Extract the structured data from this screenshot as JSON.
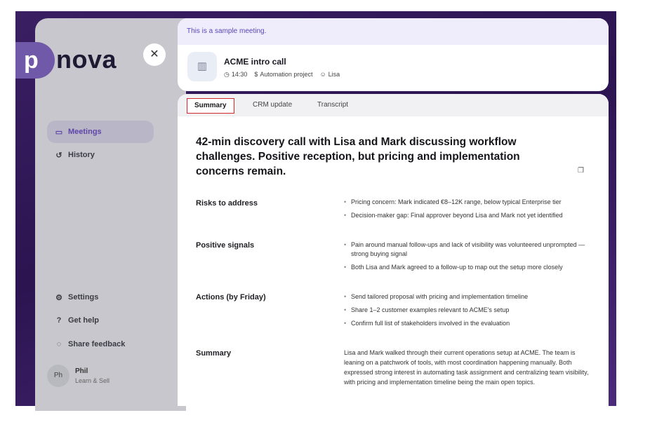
{
  "sidebar": {
    "logo_mark": "p",
    "logo_text": "nova",
    "close_label": "✕",
    "nav": [
      {
        "label": "Meetings",
        "icon": "video-icon"
      },
      {
        "label": "History",
        "icon": "history-icon"
      }
    ],
    "bottom_nav": [
      {
        "label": "Settings",
        "icon": "gear-icon"
      },
      {
        "label": "Get help",
        "icon": "help-icon"
      },
      {
        "label": "Share feedback",
        "icon": "feedback-icon"
      }
    ],
    "user": {
      "initials": "Ph",
      "name": "Phil",
      "role": "Learn & Sell"
    }
  },
  "meeting": {
    "banner": "This is a sample meeting.",
    "title": "ACME intro call",
    "time": "14:30",
    "project": "Automation project",
    "person": "Lisa"
  },
  "tabs": [
    "Summary",
    "CRM update",
    "Transcript"
  ],
  "summary": {
    "headline": "42-min discovery call with Lisa and Mark discussing workflow challenges. Positive reception, but pricing and implementation concerns remain.",
    "sections": [
      {
        "label": "Risks to address",
        "items": [
          "Pricing concern: Mark indicated €8–12K range, below typical Enterprise tier",
          "Decision-maker gap: Final approver beyond Lisa and Mark not yet identified"
        ]
      },
      {
        "label": "Positive signals",
        "items": [
          "Pain around manual follow-ups and lack of visibility was volunteered unprompted — strong buying signal",
          "Both Lisa and Mark agreed to a follow-up to map out the setup more closely"
        ]
      },
      {
        "label": "Actions (by Friday)",
        "items": [
          "Send tailored proposal with pricing and implementation timeline",
          "Share 1–2 customer examples relevant to ACME's setup",
          "Confirm full list of stakeholders involved in the evaluation"
        ]
      }
    ],
    "summary_label": "Summary",
    "summary_text": "Lisa and Mark walked through their current operations setup at ACME. The team is leaning on a patchwork of tools, with most coordination happening manually. Both expressed strong interest in automating task assignment and centralizing team visibility, with pricing and implementation timeline being the main open topics."
  }
}
